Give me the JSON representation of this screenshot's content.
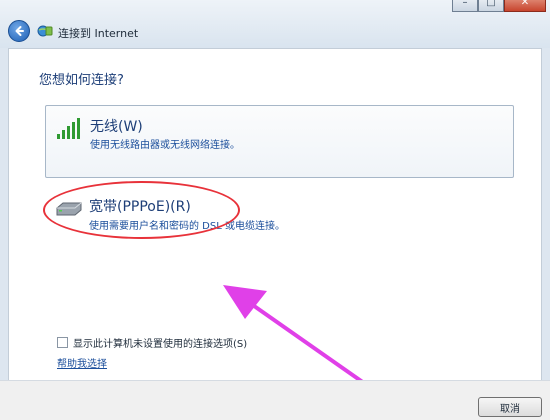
{
  "window": {
    "title": "连接到 Internet",
    "controls": {
      "minimize": "–",
      "maximize": "□",
      "close": "✕"
    }
  },
  "heading": "您想如何连接?",
  "options": [
    {
      "icon": "wireless-signal-icon",
      "title": "无线(W)",
      "description": "使用无线路由器或无线网络连接。"
    },
    {
      "icon": "modem-icon",
      "title": "宽带(PPPoE)(R)",
      "description": "使用需要用户名和密码的 DSL 或电缆连接。"
    }
  ],
  "checkbox": {
    "label": "显示此计算机未设置使用的连接选项(S)",
    "checked": false
  },
  "help_link": "帮助我选择",
  "footer": {
    "cancel_label": "取消"
  },
  "colors": {
    "heading": "#1e3f78",
    "link": "#1b4e9b",
    "annotation_oval": "#e8323a",
    "annotation_arrow": "#e040e8"
  }
}
